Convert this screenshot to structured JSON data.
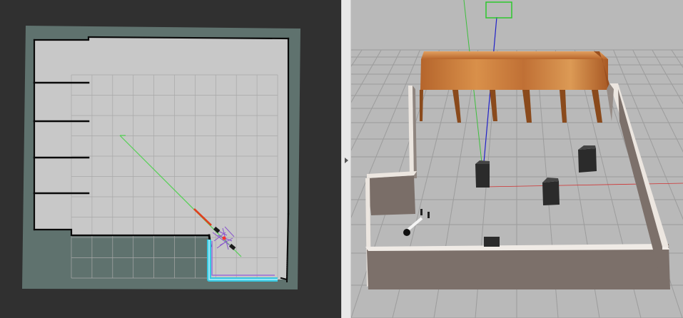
{
  "panels": {
    "left": {
      "name": "rviz-map-view",
      "background": "#303030"
    },
    "right": {
      "name": "gazebo-3d-view",
      "background": "#b8b8b8"
    }
  },
  "colors": {
    "map_unknown": "#5f726e",
    "map_free": "#c8c8c8",
    "map_occupied": "#0a0a0a",
    "grid_line": "#a4a4a4",
    "global_plan": "#52d152",
    "local_plan": "#e0401e",
    "footprint_path": "#38c8e0",
    "particles": "#8855cc",
    "wall_top": "#f0ebe6",
    "wall_face": "#7a6e68",
    "shelf_wood": "#c9793a",
    "obstacle": "#2a2a2a",
    "axis_x": "#d03030",
    "axis_y": "#3dbf3d",
    "axis_z": "#2020c8"
  }
}
